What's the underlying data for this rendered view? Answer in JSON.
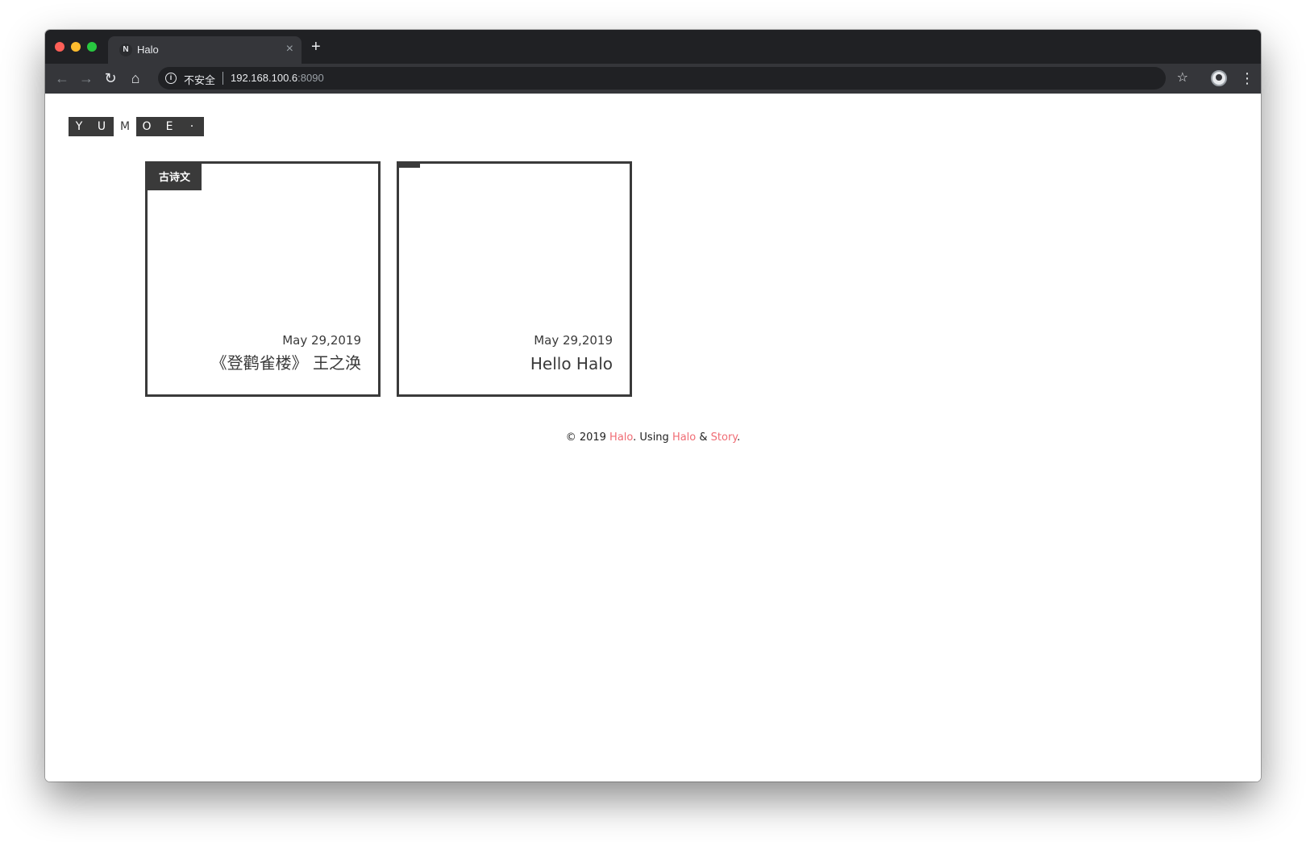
{
  "browser": {
    "tab_title": "Halo",
    "tab_favicon": "N",
    "close_glyph": "×",
    "new_tab_glyph": "+",
    "security_label": "不安全",
    "url_host": "192.168.100.6",
    "url_port": ":8090",
    "icons": {
      "back": "←",
      "forward": "→",
      "reload": "↻",
      "home": "⌂",
      "info": "i",
      "star": "☆",
      "menu": "⋮"
    }
  },
  "site": {
    "logo_left": [
      "Y",
      "U"
    ],
    "logo_middle": "M",
    "logo_right": [
      "O",
      "E",
      "·"
    ]
  },
  "posts": [
    {
      "category": "古诗文",
      "date": "May 29,2019",
      "title": "《登鹳雀楼》 王之涣"
    },
    {
      "category": "",
      "date": "May 29,2019",
      "title": "Hello Halo"
    }
  ],
  "footer": {
    "prefix": "© 2019 ",
    "link1": "Halo",
    "middle": ". Using ",
    "link2": "Halo",
    "amp": " & ",
    "link3": "Story",
    "suffix": "."
  },
  "colors": {
    "accent_link": "#f06c74",
    "dark": "#3a3a3a"
  }
}
